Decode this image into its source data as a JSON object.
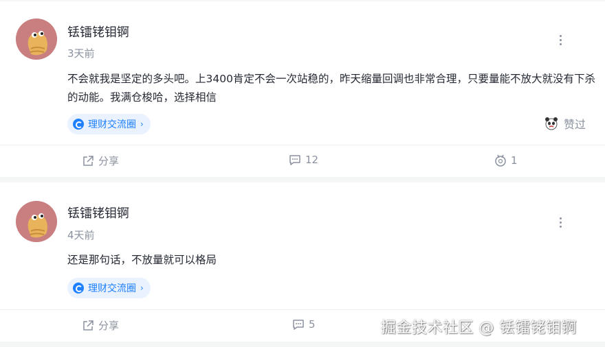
{
  "posts": [
    {
      "username": "铥镭铑钼锕",
      "time": "3天前",
      "content": "不会就我是坚定的多头吧。上3400肯定不会一次站稳的，昨天缩量回调也非常合理，只要量能不放大就没有下杀的动能。我满仓梭哈，选择相信",
      "tag": "理财交流圈",
      "reaction_label": "赞过",
      "share_label": "分享",
      "comment_count": "12",
      "like_count": "1"
    },
    {
      "username": "铥镭铑钼锕",
      "time": "4天前",
      "content": "还是那句话，不放量就可以格局",
      "tag": "理财交流圈",
      "share_label": "分享",
      "comment_count": "5"
    }
  ],
  "watermark": "掘金技术社区 @ 铥镭铑钼锕",
  "colors": {
    "accent": "#1e80ff",
    "tag_bg": "#eaf2ff",
    "avatar_bg": "#c97f80",
    "muted": "#8a919f",
    "text": "#252933"
  },
  "icons": [
    "more-icon",
    "circle-tag-icon",
    "chevron-right-icon",
    "share-icon",
    "comment-icon",
    "like-icon",
    "panda-emoji-icon"
  ]
}
